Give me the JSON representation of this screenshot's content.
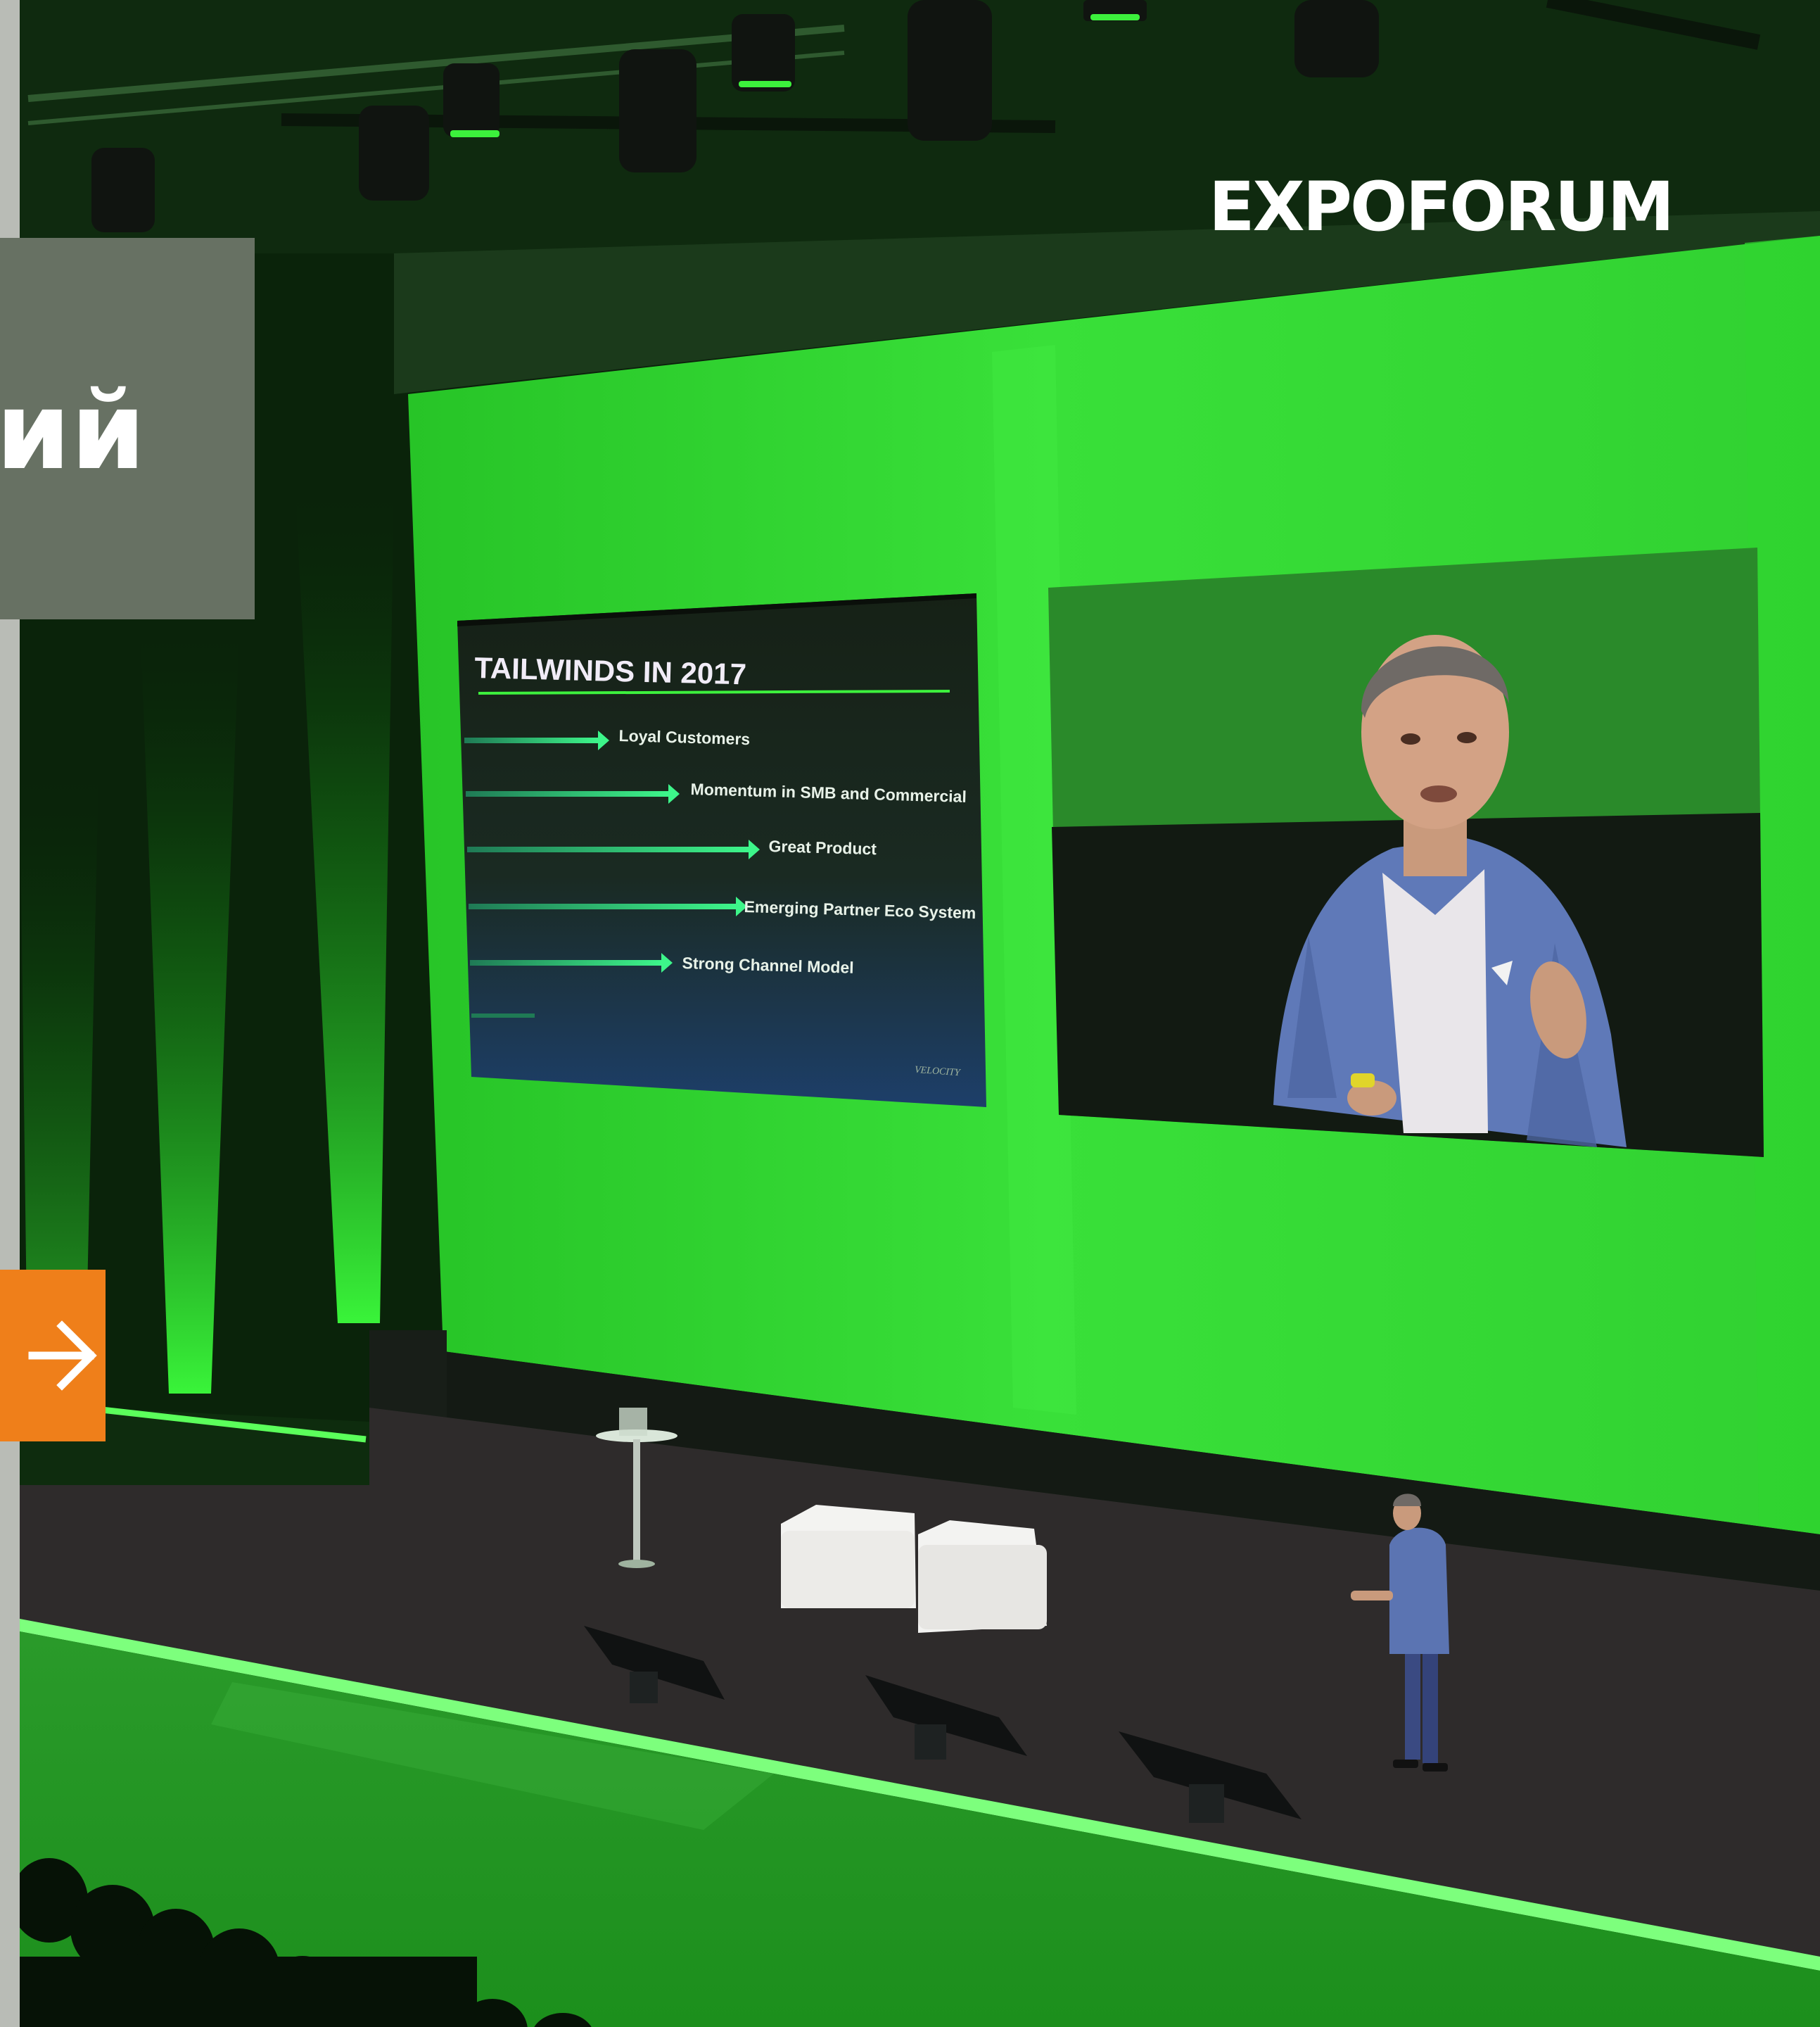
{
  "page": {
    "title_card": {
      "text": "ий"
    },
    "next_button": {
      "icon": "arrow-right-icon",
      "color": "#ef7f1a"
    },
    "brand": {
      "logo_text": "EXPOFORUM"
    }
  },
  "stage_screen": {
    "slide": {
      "title": "TAILWINDS IN 2017",
      "bullets": [
        "Loyal Customers",
        "Momentum in SMB and Commercial",
        "Great Product",
        "Emerging Partner Eco System",
        "Strong Channel Model"
      ],
      "footer": "VELOCITY"
    }
  },
  "colors": {
    "accent_orange": "#ef7f1a",
    "title_card_bg": "#677163",
    "stage_green": "#2ee62e"
  }
}
